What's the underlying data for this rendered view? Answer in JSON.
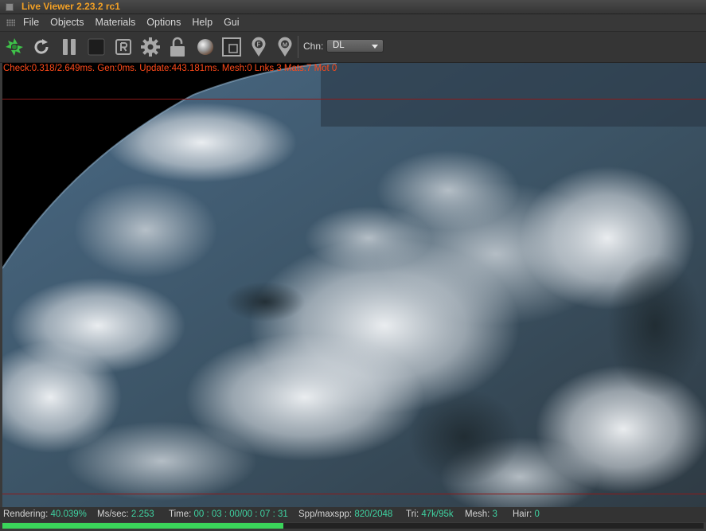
{
  "window": {
    "title": "Live Viewer 2.23.2 rc1"
  },
  "menu": [
    "File",
    "Objects",
    "Materials",
    "Options",
    "Help",
    "Gui"
  ],
  "toolbar": {
    "icons": [
      "render-start-icon",
      "restart-icon",
      "pause-icon",
      "stop-icon",
      "region-r-icon",
      "settings-gear-icon",
      "lock-icon",
      "material-sphere-icon",
      "region-select-icon",
      "focus-pin-icon",
      "material-pin-icon"
    ],
    "channel_label": "Chn:",
    "channel_value": "DL"
  },
  "viewport": {
    "stats_text": "Check:0.318/2.649ms. Gen:0ms. Update:443.181ms. Mesh:0 Lnks 3 Mats:7 Mot 0"
  },
  "status": {
    "rendering_label": "Rendering:",
    "rendering_value": "40.039%",
    "ms_label": "Ms/sec:",
    "ms_value": "2.253",
    "time_label": "Time:",
    "time_value": "00 : 03 : 00/00 : 07 : 31",
    "spp_label": "Spp/maxspp:",
    "spp_value": "820/2048",
    "tri_label": "Tri:",
    "tri_value": "47k/95k",
    "mesh_label": "Mesh:",
    "mesh_value": "3",
    "hair_label": "Hair:",
    "hair_value": "0",
    "progress": 0.40039
  },
  "colors": {
    "accent_title": "#f2a025",
    "stats_text": "#ff4a1a",
    "status_value": "#3fd3a2",
    "progress": "#3ad55a"
  }
}
